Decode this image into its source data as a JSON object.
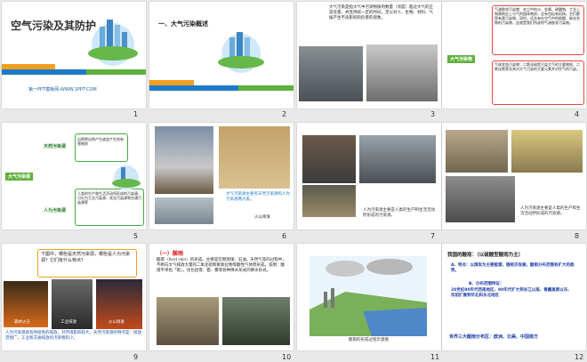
{
  "slides": [
    {
      "num": "1",
      "title": "空气污染及其防护",
      "footer": "第一PPT模板网-WWW.1PPT.COM"
    },
    {
      "num": "2",
      "heading": "一、大气污染概述"
    },
    {
      "num": "3",
      "text": "大气污染是指大气中污染物质的数量（浓度）超过大气的正常含量，并且持续一定的时间，足以对人、生物、材料、气候产生不良影响的危害的现象。"
    },
    {
      "num": "4",
      "tag": "大气污染物",
      "text_top": "气溶胶状污染物：灰尘中的沙、金属、硫酸钠、工业上和建筑业上与气的固体物质，还有包括有机体。它们都是有害污染物，同时，还含有在空气中的硫酸、碳化合物的污染物，这就是我们所说的气溶胶状污染物。",
      "text_bottom": "气体状态污染物：二氧化硫是污染大气的主要物质，二氧化氮等及其对大气污染的主要元素并对空气的污染。"
    },
    {
      "num": "5",
      "center": "大气污染源",
      "branch1": "天然污染源",
      "branch1_text": "自然界自然产生或会产生的有害物质",
      "branch2": "人为污染源",
      "branch2_text": "人类的生产和生活活动所形成的污染源，可分为工业污染源、农业污染源和交通污染源等"
    },
    {
      "num": "6",
      "caption": "火山喷发",
      "note": "大气污染源主要有天然污染源和人为污染源两大类。"
    },
    {
      "num": "7",
      "caption": "人为污染源主要是人类的生产和生活活动所形成的污染源。"
    },
    {
      "num": "8",
      "caption": "人为污染源主要是人类的生产和生活活动所形成的污染源。"
    },
    {
      "num": "9",
      "question": "下图中，哪些是天然污染源，哪些是人为污染源？它们有什么特点？",
      "labels": [
        "森林火灾",
        "工业排放",
        "火山喷发"
      ],
      "bottom": "人为污染源具有持续性的排放，对环境影响较大；天然污染源的特点是：排放范围广，工业和交通排放的污染物较少。"
    },
    {
      "num": "10",
      "heading": "（一）酸雨",
      "text": "酸雨（Acid rain）的形成。主要是在燃烧煤、石油、天然气等的过程中，不断向大气排放大量的二氧化硫和氮氧化物等酸性气体而形成。说明：酸雨不单指「雨」，也包括雪、雹、雾等各种降水形式的降水形式。"
    },
    {
      "num": "11",
      "caption": "酸雨的形成过程示意图"
    },
    {
      "num": "12",
      "heading": "我国的酸雨：（以硫酸型酸雨为主）",
      "point_a": "A、特点：以煤炭为主要能源，随经济发展，酸雨分布范围有扩大的趋势。",
      "point_b": "B、分布范围特征：",
      "point_b1": "20世纪80年代西南地区、90年代扩大到长江以南、青藏高原以东、目前扩展到华北和东北地区",
      "bottom": "世界三大酸雨分布区：欧洲、北美、中国南方"
    }
  ],
  "colors": {
    "orange": "#f0a020",
    "blue": "#1e7ac8",
    "green": "#5fb13c",
    "red": "#d22222"
  }
}
